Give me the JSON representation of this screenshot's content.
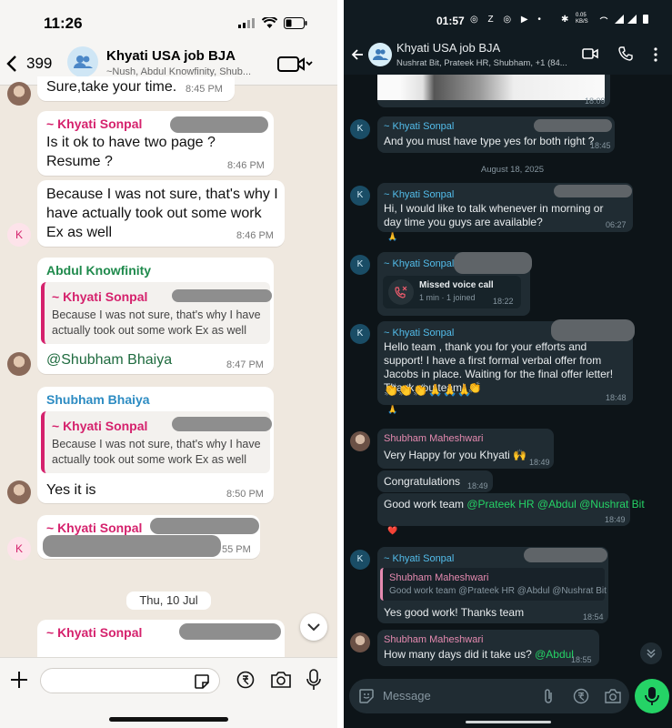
{
  "left": {
    "status": {
      "time": "11:26"
    },
    "header": {
      "back_count": "399",
      "title": "Khyati USA job BJA",
      "subtitle": "~Nush, Abdul Knowfinity, Shub..."
    },
    "messages": [
      {
        "text": "Sure,take your time.",
        "time": "8:45 PM"
      },
      {
        "sender": "~ Khyati Sonpal",
        "text": "Is it ok to have two page ? Resume ?",
        "time": "8:46 PM"
      },
      {
        "text": "Because I was not sure, that's why I have actually took out some work Ex as well",
        "time": "8:46 PM",
        "avatar": "K"
      },
      {
        "sender": "Abdul Knowfinity",
        "quote_sender": "~ Khyati Sonpal",
        "quote_text": "Because I was not sure, that's why I have actually took out some work Ex as well",
        "text": "@Shubham  Bhaiya",
        "time": "8:47 PM"
      },
      {
        "sender": "Shubham  Bhaiya",
        "quote_sender": "~ Khyati Sonpal",
        "quote_text": "Because I was not sure, that's why I have actually took out some work Ex as well",
        "text": "Yes it is",
        "time": "8:50 PM"
      },
      {
        "sender": "~ Khyati Sonpal",
        "time": "55 PM",
        "avatar": "K"
      },
      {
        "sender": "~ Khyati Sonpal"
      }
    ],
    "date_chip": "Thu, 10 Jul"
  },
  "right": {
    "status": {
      "time": "01:57",
      "net": "0.05 KB/S"
    },
    "header": {
      "title": "Khyati USA job BJA",
      "subtitle": "Nushrat Bit, Prateek HR, Shubham, +1 (84..."
    },
    "top_time": "18:09",
    "messages": [
      {
        "sender": "~ Khyati Sonpal",
        "text": "And you must have type yes for both right ?",
        "time": "18:45",
        "avatar": "K"
      },
      {
        "sender": "~ Khyati Sonpal",
        "text": "Hi, I would like to talk whenever in morning or day time you guys are available?",
        "time": "06:27",
        "avatar": "K",
        "reaction": "🙏"
      },
      {
        "sender": "~ Khyati Sonpal",
        "call_title": "Missed voice call",
        "call_sub": "1 min · 1 joined",
        "time": "18:22",
        "avatar": "K"
      },
      {
        "sender": "~ Khyati Sonpal",
        "text": "Hello team , thank you for your efforts and support! I have a first formal verbal offer from Jacobs in place. Waiting for the final offer letter! Thank you team! 👏",
        "emoji_line": "👏👏👏🙏🙏🙏",
        "time": "18:48",
        "avatar": "K",
        "reaction": "🙏"
      },
      {
        "sender": "Shubham Maheshwari",
        "text": "Very Happy for you Khyati 🙌",
        "time": "18:49"
      },
      {
        "text": "Congratulations",
        "time": "18:49"
      },
      {
        "text_prefix": "Good work team ",
        "mentions": "@Prateek HR @Abdul @Nushrat Bit",
        "time": "18:49",
        "reaction": "❤️"
      },
      {
        "sender": "~ Khyati Sonpal",
        "quote_sender": "Shubham Maheshwari",
        "quote_text": "Good work team @Prateek HR @Abdul @Nushrat Bit",
        "text": "Yes good work! Thanks team",
        "time": "18:54",
        "avatar": "K"
      },
      {
        "sender": "Shubham Maheshwari",
        "text_prefix": "How many days did it take us? ",
        "mentions": "@Abdul",
        "time": "18:55"
      }
    ],
    "date_chip": "August 18, 2025",
    "input_placeholder": "Message"
  },
  "colors": {
    "left_accent_pink": "#d5226d",
    "left_green": "#1f8a4c",
    "left_blue": "#2c8bc2",
    "dark_green": "#25d366",
    "dark_pink": "#e58ab0",
    "dark_blue": "#53bdeb"
  }
}
